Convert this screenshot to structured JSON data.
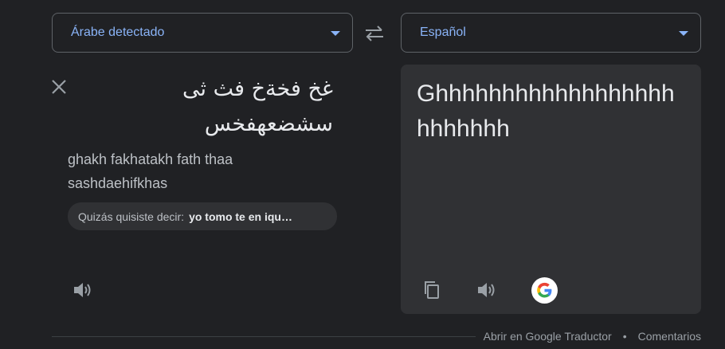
{
  "source_language": {
    "label": "Árabe detectado"
  },
  "target_language": {
    "label": "Español"
  },
  "source": {
    "text": "غخ فخةخ فث ثى سشضعهفخس",
    "transliteration": "ghakh fakhatakh fath thaa sashdaehifkhas",
    "suggestion_prefix": "Quizás quisiste decir:",
    "suggestion_value": "yo tomo te en iqu…"
  },
  "target": {
    "text": "Ghhhhhhhhhhhhhhhhhhhhhhhhh"
  },
  "footer": {
    "open_link": "Abrir en Google Traductor",
    "separator": "•",
    "feedback_link": "Comentarios"
  },
  "colors": {
    "background": "#202124",
    "panel": "#303134",
    "accent": "#8ab4f8",
    "border": "#5f6368"
  },
  "icons": [
    "chevron-down-icon",
    "swap-icon",
    "close-icon",
    "speaker-icon",
    "copy-icon",
    "google-logo-icon"
  ]
}
